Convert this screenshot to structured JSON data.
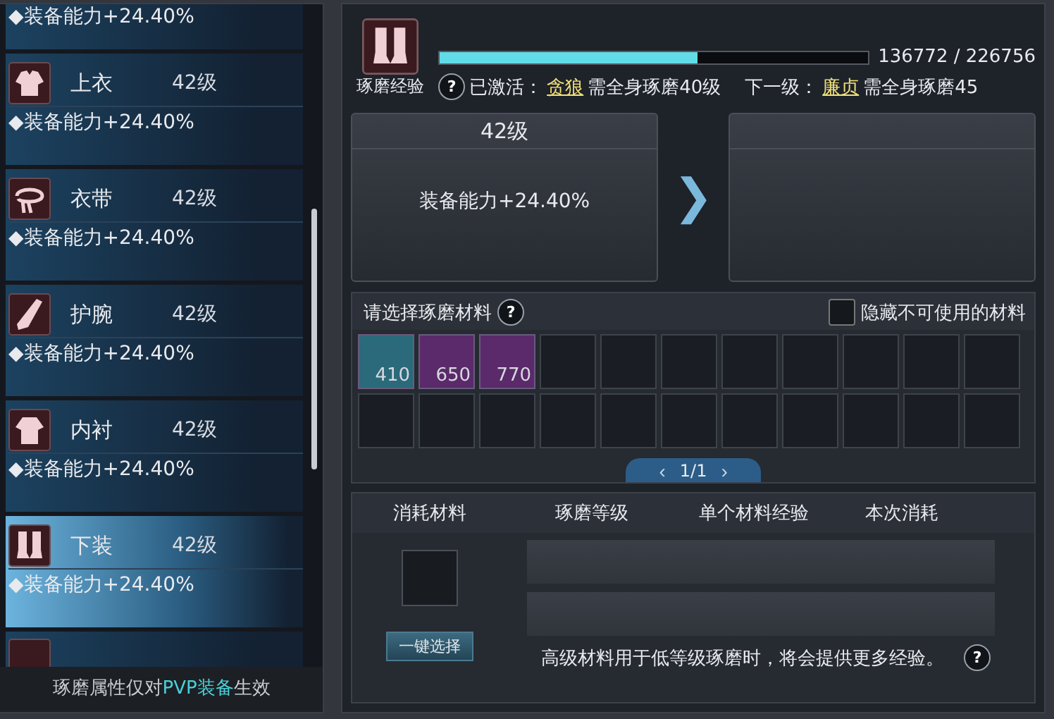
{
  "sidebar": {
    "top_partial_stat": "◆装备能力+24.40%",
    "items": [
      {
        "kind": "jacket",
        "name": "上衣",
        "level": "42级",
        "stat": "◆装备能力+24.40%",
        "selected": false
      },
      {
        "kind": "belt",
        "name": "衣带",
        "level": "42级",
        "stat": "◆装备能力+24.40%",
        "selected": false
      },
      {
        "kind": "bracer",
        "name": "护腕",
        "level": "42级",
        "stat": "◆装备能力+24.40%",
        "selected": false
      },
      {
        "kind": "shirt",
        "name": "内衬",
        "level": "42级",
        "stat": "◆装备能力+24.40%",
        "selected": false
      },
      {
        "kind": "pants",
        "name": "下装",
        "level": "42级",
        "stat": "◆装备能力+24.40%",
        "selected": true
      }
    ],
    "footer": "琢磨属性仅对**PVP装备**生效"
  },
  "experience": {
    "label": "琢磨经验",
    "level": 0.603,
    "reading": "136772 / 226756",
    "help": "?",
    "active_label": "已激活：",
    "active_name": "贪狼",
    "active_req": "需全身琢磨40级",
    "next_label": "下一级：",
    "next_name": "廉贞",
    "next_req": "需全身琢磨45"
  },
  "current": {
    "level": "42级",
    "stat": "装备能力+24.40%"
  },
  "arrow": "❯",
  "materials": {
    "title": "请选择琢磨材料",
    "help": "?",
    "hide_label": "隐藏不可使用的材料",
    "hide_checked": false,
    "items": [
      {
        "count": "410",
        "color": "#2a6a7a"
      },
      {
        "count": "650",
        "color": "#5a2a6a"
      },
      {
        "count": "770",
        "color": "#5a2a6a"
      }
    ],
    "pager": {
      "prev": "‹",
      "page": "1/1",
      "next": "›"
    }
  },
  "consume": {
    "columns": [
      "消耗材料",
      "琢磨等级",
      "单个材料经验",
      "本次消耗"
    ],
    "button": "一键选择",
    "note": "高级材料用于低等级琢磨时，将会提供更多经验。",
    "help": "?"
  }
}
